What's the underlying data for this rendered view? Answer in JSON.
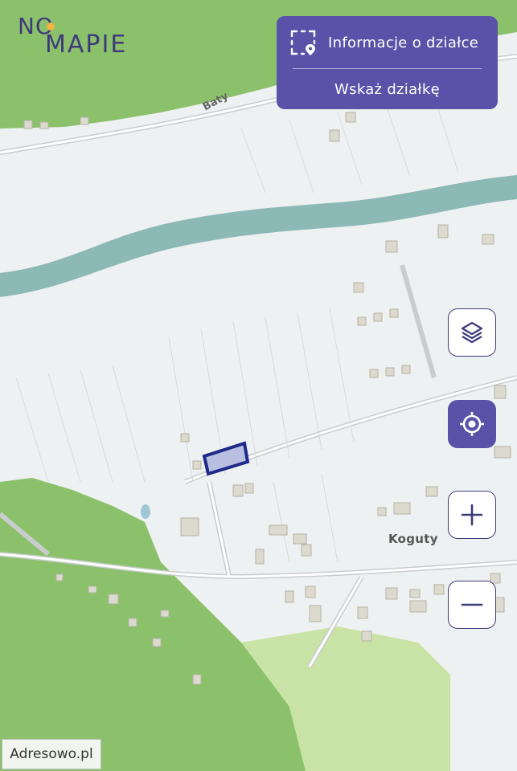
{
  "logo": {
    "line1": "NO",
    "line2": "MAPIE"
  },
  "panel": {
    "parcel_info_label": "Informacje o działce",
    "parcel_info_icon": "parcel-select-pin-icon",
    "point_parcel_label": "Wskaż działkę"
  },
  "controls": [
    {
      "name": "layers-button",
      "icon": "layers-icon"
    },
    {
      "name": "locate-button",
      "icon": "crosshair-locate-icon"
    },
    {
      "name": "zoom-in-button",
      "icon": "plus-icon"
    },
    {
      "name": "zoom-out-button",
      "icon": "minus-icon"
    }
  ],
  "map": {
    "street_label": "Baty",
    "place_label": "Koguty",
    "colors": {
      "forest": "#8cc16c",
      "meadow": "#c9e3a6",
      "river": "#8cb8b5",
      "land": "#eef1f1",
      "parcel_outline": "#1e2a8a",
      "parcel_fill": "#b9bfe0",
      "accent": "#5a52a8"
    }
  },
  "watermark": "Adresowo.pl"
}
